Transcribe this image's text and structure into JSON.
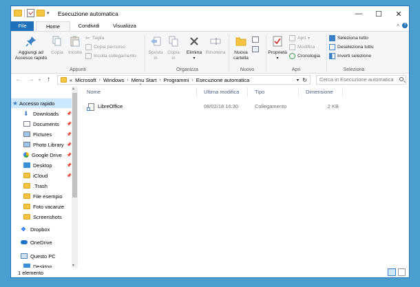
{
  "window": {
    "title": "Esecuzione automatica"
  },
  "window_controls": {
    "minimize": "—",
    "maximize": "☐",
    "close": "✕"
  },
  "tabs": [
    {
      "label": "File"
    },
    {
      "label": "Home"
    },
    {
      "label": "Condividi"
    },
    {
      "label": "Visualizza"
    }
  ],
  "ribbon": {
    "groups": {
      "appunti": "Appunti",
      "organizza": "Organizza",
      "nuovo": "Nuovo",
      "apri": "Apri",
      "seleziona": "Seleziona"
    },
    "pin_label_1": "Aggiungi ad",
    "pin_label_2": "Accesso rapido",
    "copia": "Copia",
    "incolla": "Incolla",
    "taglia": "Taglia",
    "copia_percorso": "Copia percorso",
    "incolla_collegamento": "Incolla collegamento",
    "sposta_1": "Sposta",
    "sposta_2": "in",
    "copia_in_1": "Copia",
    "copia_in_2": "in",
    "elimina": "Elimina",
    "rinomina": "Rinomina",
    "nuova_1": "Nuova",
    "nuova_2": "cartella",
    "proprieta": "Proprietà",
    "apri": "Apri",
    "modifica": "Modifica",
    "cronologia": "Cronologia",
    "seleziona_tutto": "Seleziona tutto",
    "deseleziona_tutto": "Deseleziona tutto",
    "inverti_selezione": "Inverti selezione"
  },
  "address": {
    "overflow": "«",
    "crumbs": [
      "Microsoft",
      "Windows",
      "Menu Start",
      "Programmi",
      "Esecuzione automatica"
    ],
    "search_placeholder": "Cerca in Esecuzione automatica"
  },
  "nav": {
    "items": [
      {
        "label": "Accesso rapido"
      },
      {
        "label": "Downloads"
      },
      {
        "label": "Documents"
      },
      {
        "label": "Pictures"
      },
      {
        "label": "Photo Library"
      },
      {
        "label": "Google Drive"
      },
      {
        "label": "Desktop"
      },
      {
        "label": "iCloud"
      },
      {
        "label": ".Trash"
      },
      {
        "label": "File esempio"
      },
      {
        "label": "Foto vacanze"
      },
      {
        "label": "Screenshots"
      },
      {
        "label": "Dropbox"
      },
      {
        "label": "OneDrive"
      },
      {
        "label": "Questo PC"
      },
      {
        "label": "Desktop"
      }
    ]
  },
  "columns": {
    "name": "Nome",
    "modified": "Ultima modifica",
    "type": "Tipo",
    "size": "Dimensione"
  },
  "files": [
    {
      "name": "LibreOffice",
      "modified": "08/02/18 16:30",
      "type": "Collegamento",
      "size": "2 KB"
    }
  ],
  "status": {
    "count": "1 elemento"
  },
  "colors": {
    "accent": "#1f72b8",
    "selected": "#cce8ff",
    "folder": "#f5c542"
  }
}
